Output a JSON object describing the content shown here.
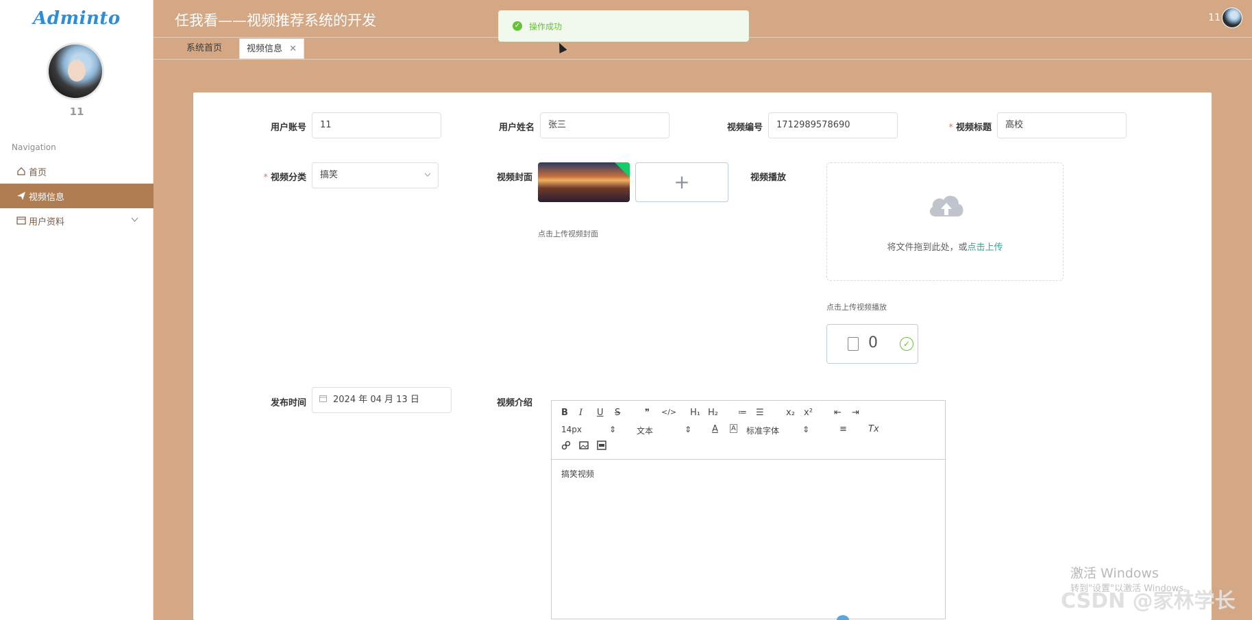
{
  "app": {
    "brand": "Adminto",
    "brand_suffix": "to",
    "title": "任我看——视频推荐系统的开发"
  },
  "user": {
    "name": "11"
  },
  "nav": {
    "section_title": "Navigation",
    "items": [
      {
        "label": "首页",
        "icon": "home-icon"
      },
      {
        "label": "视频信息",
        "icon": "paper-plane-icon"
      },
      {
        "label": "用户资料",
        "icon": "profile-card-icon"
      }
    ]
  },
  "tabs": [
    {
      "label": "系统首页"
    },
    {
      "label": "视频信息",
      "close": "✕"
    }
  ],
  "toast": {
    "message": "操作成功",
    "type": "success"
  },
  "form": {
    "account": {
      "label": "用户账号",
      "value": "11"
    },
    "name": {
      "label": "用户姓名",
      "value": "张三"
    },
    "video_no": {
      "label": "视频编号",
      "value": "1712989578690"
    },
    "video_title": {
      "label": "视频标题",
      "value": "高校",
      "required": "*"
    },
    "category": {
      "label": "视频分类",
      "value": "搞笑",
      "required": "*"
    },
    "cover": {
      "label": "视频封面",
      "hint": "点击上传视频封面",
      "add": "+"
    },
    "play": {
      "label": "视频播放",
      "drag_text": "将文件拖到此处，或",
      "drag_link": "点击上传",
      "hint": "点击上传视频播放",
      "file_count": "0"
    },
    "publish_time": {
      "label": "发布时间",
      "value": "2024 年 04 月 13 日"
    },
    "intro": {
      "label": "视频介绍",
      "font_size": "14px",
      "header_select": "文本",
      "font_family": "标准字体",
      "content": "搞笑视频",
      "buttons": {
        "bold": "B",
        "italic": "I",
        "underline": "U",
        "strike": "S",
        "quote": "❞",
        "code": "</>",
        "h1": "H₁",
        "h2": "H₂",
        "ol": "≔",
        "ul": "☰",
        "sub": "x₂",
        "sup": "x²",
        "outdent": "⇤",
        "indent": "⇥",
        "color": "A",
        "bg": "A",
        "align": "≡",
        "clean": "Tx"
      }
    }
  },
  "watermark": {
    "line1": "激活 Windows",
    "line2": "转到\"设置\"以激活 Windows。",
    "csdn": "CSDN @家林学长"
  },
  "colors": {
    "accent": "#b07d52",
    "background": "#d4a785",
    "success": "#67c23a",
    "link": "#3aa28b"
  }
}
